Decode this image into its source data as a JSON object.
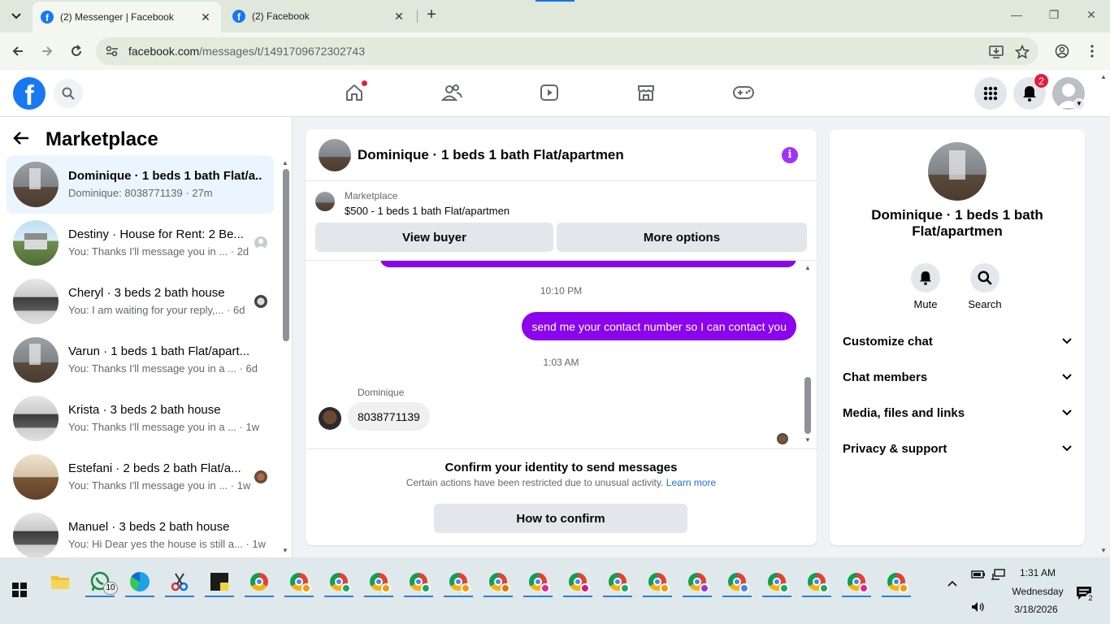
{
  "browser": {
    "tabs": [
      {
        "title": "(2) Messenger | Facebook",
        "active": true
      },
      {
        "title": "(2) Facebook",
        "active": false
      }
    ],
    "url_domain": "facebook.com",
    "url_path": "/messages/t/1491709672302743"
  },
  "header": {
    "notification_count": "2"
  },
  "left": {
    "title": "Marketplace",
    "conversations": [
      {
        "name": "Dominique · 1 beds 1 bath Flat/a...",
        "snippet": "Dominique: 8038771139 · 27m",
        "unread": true
      },
      {
        "name": "Destiny · House for Rent: 2 Be...",
        "snippet": "You: Thanks I'll message you in ... · 2d"
      },
      {
        "name": "Cheryl · 3 beds 2 bath house",
        "snippet": "You: I am waiting for your reply,... · 6d"
      },
      {
        "name": "Varun · 1 beds 1 bath Flat/apart...",
        "snippet": "You: Thanks I'll message you in a ... · 6d"
      },
      {
        "name": "Krista · 3 beds 2 bath house",
        "snippet": "You: Thanks I'll message you in a ... · 1w"
      },
      {
        "name": "Estefani · 2 beds 2 bath Flat/a...",
        "snippet": "You: Thanks I'll message you in ... · 1w"
      },
      {
        "name": "Manuel · 3 beds 2 bath house",
        "snippet": "You: Hi Dear yes the house is still a... · 1w"
      }
    ]
  },
  "chat": {
    "title": "Dominique · 1 beds 1 bath Flat/apartmen",
    "marketplace_label": "Marketplace",
    "listing": "$500 - 1 beds 1 bath Flat/apartmen",
    "view_buyer": "View buyer",
    "more_options": "More options",
    "time1": "10:10 PM",
    "outgoing": "send me your contact number so I can contact you",
    "time2": "1:03 AM",
    "sender": "Dominique",
    "incoming": "8038771139",
    "confirm_title": "Confirm your identity to send messages",
    "confirm_sub": "Certain actions have been restricted due to unusual activity.",
    "learn_more": "Learn more",
    "how_to_confirm": "How to confirm"
  },
  "right": {
    "name": "Dominique · 1 beds 1 bath Flat/apartmen",
    "mute": "Mute",
    "search": "Search",
    "sections": [
      "Customize chat",
      "Chat members",
      "Media, files and links",
      "Privacy & support"
    ]
  },
  "taskbar": {
    "whatsapp_badge": "10",
    "time": "1:31 AM",
    "day": "Wednesday",
    "date": "3/18/2026",
    "notif_count": "2",
    "chrome_profile_colors": [
      "#f29900",
      "#16a765",
      "#f29900",
      "#16a765",
      "#f29900",
      "#e8710a",
      "#e52592",
      "#d01884",
      "#16a765",
      "#f29900",
      "#9334e6",
      "#4285f4",
      "#16a765",
      "#16a765",
      "#e52592",
      "#f29900"
    ]
  }
}
